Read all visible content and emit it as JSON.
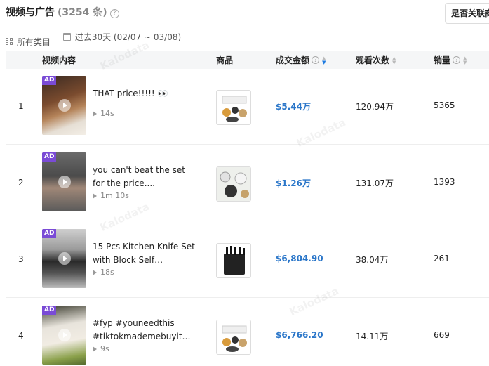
{
  "header": {
    "title": "视频与广告",
    "count": "(3254 条)",
    "help": "?",
    "ad_filter": "是否关联商"
  },
  "filters": {
    "category": "所有类目",
    "date_range": "过去30天 (02/07 ~ 03/08)"
  },
  "columns": {
    "video": "视频内容",
    "product": "商品",
    "revenue": "成交金额",
    "views": "观看次数",
    "sales": "销量"
  },
  "rows": [
    {
      "index": "1",
      "badge": "AD",
      "desc": "THAT price!!!!! 👀",
      "duration": "14s",
      "revenue": "$5.44万",
      "views": "120.94万",
      "sales": "5365"
    },
    {
      "index": "2",
      "badge": "AD",
      "desc": "you can't beat the set for the price....",
      "duration": "1m 10s",
      "revenue": "$1.26万",
      "views": "131.07万",
      "sales": "1393"
    },
    {
      "index": "3",
      "badge": "AD",
      "desc": "15 Pcs Kitchen Knife Set with Block Self…",
      "duration": "18s",
      "revenue": "$6,804.90",
      "views": "38.04万",
      "sales": "261"
    },
    {
      "index": "4",
      "badge": "AD",
      "desc": "#fyp #youneedthis #tiktokmademebuyit…",
      "duration": "9s",
      "revenue": "$6,766.20",
      "views": "14.11万",
      "sales": "669"
    }
  ],
  "watermark": "Kalodata",
  "colors": {
    "accent": "#2a76c9",
    "ad_badge": "#7a4bd6",
    "header_bg": "#f5f6f7"
  }
}
